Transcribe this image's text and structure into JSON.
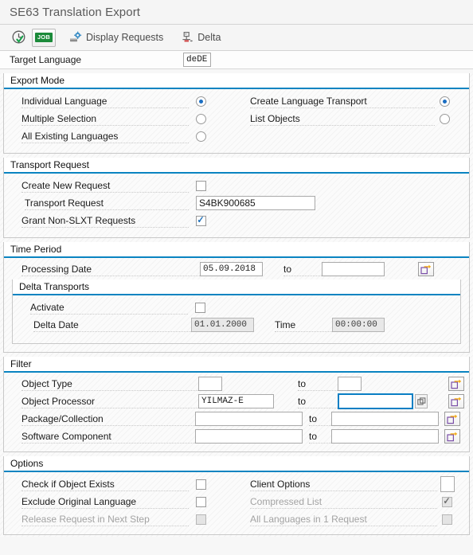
{
  "window": {
    "title": "SE63 Translation Export"
  },
  "toolbar": {
    "execute_icon": "execute-clock-check-icon",
    "job_label": "JOB",
    "display_requests_label": "Display Requests",
    "display_requests_icon": "display-requests-icon",
    "delta_label": "Delta",
    "delta_icon": "delta-icon"
  },
  "target_language": {
    "label": "Target Language",
    "value": "deDE"
  },
  "export_mode": {
    "title": "Export Mode",
    "left": [
      {
        "label": "Individual Language",
        "selected": true
      },
      {
        "label": "Multiple Selection",
        "selected": false
      },
      {
        "label": "All Existing Languages",
        "selected": false
      }
    ],
    "right": [
      {
        "label": "Create Language Transport",
        "selected": true
      },
      {
        "label": "List Objects",
        "selected": false
      }
    ]
  },
  "transport_request": {
    "title": "Transport Request",
    "create_new_label": "Create New Request",
    "create_new_checked": false,
    "request_label": "Transport Request",
    "request_value": "S4BK900685",
    "grant_label": "Grant Non-SLXT Requests",
    "grant_checked": true
  },
  "time_period": {
    "title": "Time Period",
    "processing_date_label": "Processing Date",
    "processing_date_from": "05.09.2018",
    "processing_date_to": "",
    "to_label": "to",
    "delta": {
      "title": "Delta Transports",
      "activate_label": "Activate",
      "activate_checked": false,
      "delta_date_label": "Delta Date",
      "delta_date_value": "01.01.2000",
      "time_label": "Time",
      "time_value": "00:00:00"
    }
  },
  "filter": {
    "title": "Filter",
    "to_label": "to",
    "rows": [
      {
        "label": "Object Type",
        "from": "",
        "to": "",
        "narrow": true,
        "focused": false
      },
      {
        "label": "Object Processor",
        "from": "YILMAZ-E",
        "to": "",
        "narrow": false,
        "focused": true
      },
      {
        "label": "Package/Collection",
        "from": "",
        "to": "",
        "narrow": false,
        "focused": false
      },
      {
        "label": "Software Component",
        "from": "",
        "to": "",
        "narrow": false,
        "focused": false
      }
    ]
  },
  "options": {
    "title": "Options",
    "left": [
      {
        "label": "Check if Object Exists",
        "checked": false,
        "disabled": false
      },
      {
        "label": "Exclude Original Language",
        "checked": false,
        "disabled": false
      },
      {
        "label": "Release Request in Next Step",
        "checked": false,
        "disabled": true
      }
    ],
    "right": [
      {
        "label": "Client Options",
        "type": "input",
        "value": "",
        "disabled": false
      },
      {
        "label": "Compressed List",
        "type": "checkbox",
        "checked": true,
        "disabled": true
      },
      {
        "label": "All Languages in 1 Request",
        "type": "checkbox",
        "checked": false,
        "disabled": true
      }
    ]
  },
  "colors": {
    "accent": "#0a84c1",
    "focus": "#0a7fc4",
    "focus_marker": "#e02020",
    "job_green": "#1b8a3a"
  }
}
